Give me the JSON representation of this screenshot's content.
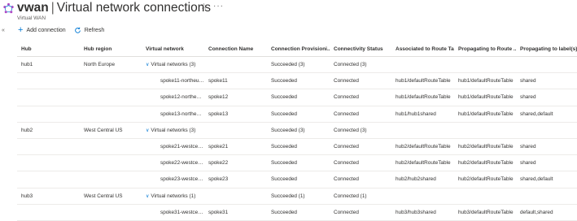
{
  "header": {
    "resource_name": "vwan",
    "separator": "|",
    "page_title": "Virtual network connections",
    "subtitle": "Virtual WAN",
    "favorite_icon": "star-icon",
    "more_icon": "ellipsis-icon"
  },
  "toolbar": {
    "add_label": "Add connection",
    "refresh_label": "Refresh"
  },
  "table": {
    "columns": [
      "Hub",
      "Hub region",
      "Virtual network",
      "Connection Name",
      "Connection Provisioni...",
      "Connectivity Status",
      "Associated to Route Ta...",
      "Propagating to Route ...",
      "Propagating to label(s)"
    ],
    "rows": [
      {
        "hub": "hub1",
        "region": "North Europe",
        "vnet": "Virtual networks (3)",
        "name": "",
        "prov": "Succeeded (3)",
        "status": "Connected (3)",
        "assoc": "",
        "prop": "",
        "labels": ""
      },
      {
        "hub": "",
        "region": "",
        "vnet": "spoke11-northeur...",
        "name": "spoke11",
        "prov": "Succeeded",
        "status": "Connected",
        "assoc": "hub1/defaultRouteTable",
        "prop": "hub1/defaultRouteTable",
        "labels": "shared"
      },
      {
        "hub": "",
        "region": "",
        "vnet": "spoke12-northeur...",
        "name": "spoke12",
        "prov": "Succeeded",
        "status": "Connected",
        "assoc": "hub1/defaultRouteTable",
        "prop": "hub1/defaultRouteTable",
        "labels": "shared"
      },
      {
        "hub": "",
        "region": "",
        "vnet": "spoke13-northeur...",
        "name": "spoke13",
        "prov": "Succeeded",
        "status": "Connected",
        "assoc": "hub1/hub1shared",
        "prop": "hub1/defaultRouteTable",
        "labels": "shared,default"
      },
      {
        "hub": "hub2",
        "region": "West Central US",
        "vnet": "Virtual networks (3)",
        "name": "",
        "prov": "Succeeded (3)",
        "status": "Connected (3)",
        "assoc": "",
        "prop": "",
        "labels": ""
      },
      {
        "hub": "",
        "region": "",
        "vnet": "spoke21-westcen...",
        "name": "spoke21",
        "prov": "Succeeded",
        "status": "Connected",
        "assoc": "hub2/defaultRouteTable",
        "prop": "hub2/defaultRouteTable",
        "labels": "shared"
      },
      {
        "hub": "",
        "region": "",
        "vnet": "spoke22-westcen...",
        "name": "spoke22",
        "prov": "Succeeded",
        "status": "Connected",
        "assoc": "hub2/defaultRouteTable",
        "prop": "hub2/defaultRouteTable",
        "labels": "shared"
      },
      {
        "hub": "",
        "region": "",
        "vnet": "spoke23-westcen...",
        "name": "spoke23",
        "prov": "Succeeded",
        "status": "Connected",
        "assoc": "hub2/hub2shared",
        "prop": "hub2/defaultRouteTable",
        "labels": "shared,default"
      },
      {
        "hub": "hub3",
        "region": "West Central US",
        "vnet": "Virtual networks (1)",
        "name": "",
        "prov": "Succeeded (1)",
        "status": "Connected (1)",
        "assoc": "",
        "prop": "",
        "labels": ""
      },
      {
        "hub": "",
        "region": "",
        "vnet": "spoke31-westcen...",
        "name": "spoke31",
        "prov": "Succeeded",
        "status": "Connected",
        "assoc": "hub3/hub3shared",
        "prop": "hub3/defaultRouteTable",
        "labels": "default,shared"
      }
    ]
  },
  "colors": {
    "link": "#0078d4",
    "text": "#323130",
    "secondary": "#605e5c",
    "border": "#edebe9",
    "resource_icon": "#b146c2"
  }
}
